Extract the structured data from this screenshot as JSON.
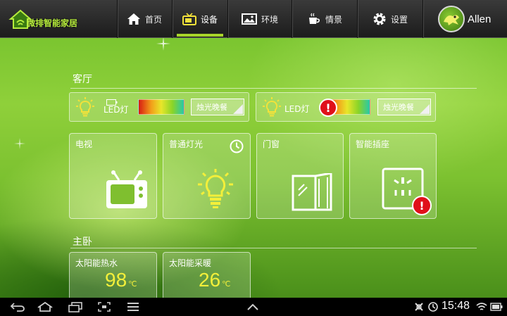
{
  "app": {
    "logo_text": "微排智能家居",
    "nav": [
      {
        "label": "首页",
        "icon": "home-icon"
      },
      {
        "label": "设备",
        "icon": "tv-icon",
        "active": true
      },
      {
        "label": "环境",
        "icon": "picture-icon"
      },
      {
        "label": "情景",
        "icon": "cup-icon"
      },
      {
        "label": "设置",
        "icon": "gear-icon"
      }
    ],
    "user": {
      "name": "Allen"
    }
  },
  "rooms": {
    "living": {
      "title": "客厅",
      "led_lights": [
        {
          "label": "LED灯",
          "mode": "烛光晚餐",
          "alert": false
        },
        {
          "label": "LED灯",
          "mode": "烛光晚餐",
          "alert": true
        }
      ],
      "tiles": [
        {
          "label": "电视",
          "icon": "tv-icon"
        },
        {
          "label": "普通灯光",
          "icon": "lightbulb-icon",
          "timer_icon": "clock-icon"
        },
        {
          "label": "门窗",
          "icon": "window-icon"
        },
        {
          "label": "智能插座",
          "icon": "power-socket-icon",
          "alert": true
        }
      ]
    },
    "bedroom": {
      "title": "主卧",
      "tiles": [
        {
          "label": "太阳能热水",
          "value": "98",
          "unit": "℃"
        },
        {
          "label": "太阳能采暖",
          "value": "26",
          "unit": "℃"
        }
      ]
    }
  },
  "alert_symbol": "!",
  "system_bar": {
    "time": "15:48"
  },
  "colors": {
    "accent": "#a8d42a",
    "temp": "#f3ef3a",
    "alert": "#e0101a"
  }
}
